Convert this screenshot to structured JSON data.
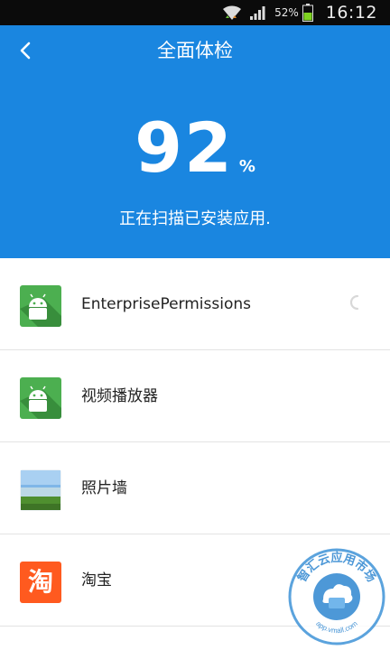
{
  "status_bar": {
    "battery_percent": "52%",
    "time": "16:12",
    "icons": [
      "wifi-icon",
      "signal-icon",
      "battery-icon"
    ]
  },
  "header": {
    "title": "全面体检",
    "score": "92",
    "score_unit": "%",
    "status": "正在扫描已安装应用.",
    "background_color": "#1a86e0"
  },
  "apps": [
    {
      "name": "EnterprisePermissions",
      "icon": "android-app-icon",
      "scanning": true
    },
    {
      "name": "视频播放器",
      "icon": "android-app-icon",
      "scanning": false
    },
    {
      "name": "照片墙",
      "icon": "photo-wall-icon",
      "scanning": false
    },
    {
      "name": "淘宝",
      "icon": "taobao-icon",
      "icon_text": "淘",
      "scanning": false
    }
  ],
  "watermark": {
    "text": "智汇云应用市场",
    "url_text": "app.vmall.com"
  }
}
